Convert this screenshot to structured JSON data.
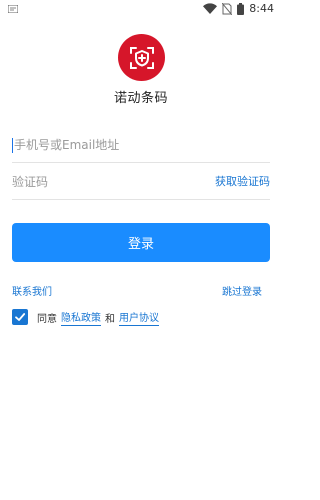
{
  "status_bar": {
    "time": "8:44",
    "icons": [
      "notification-icon",
      "wifi-icon",
      "no-sim-icon",
      "battery-icon"
    ]
  },
  "app": {
    "name": "诺动条码",
    "logo_icon": "scan-shield-icon",
    "logo_color": "#d6162a"
  },
  "form": {
    "phone_placeholder": "手机号或Email地址",
    "phone_value": "",
    "code_placeholder": "验证码",
    "code_value": "",
    "get_code_label": "获取验证码",
    "login_label": "登录"
  },
  "links": {
    "contact": "联系我们",
    "skip": "跳过登录"
  },
  "agreement": {
    "checked": true,
    "prefix": "同意",
    "privacy": "隐私政策",
    "and": "和",
    "terms": "用户协议"
  },
  "colors": {
    "accent": "#1976d2",
    "button": "#1a8cff"
  }
}
